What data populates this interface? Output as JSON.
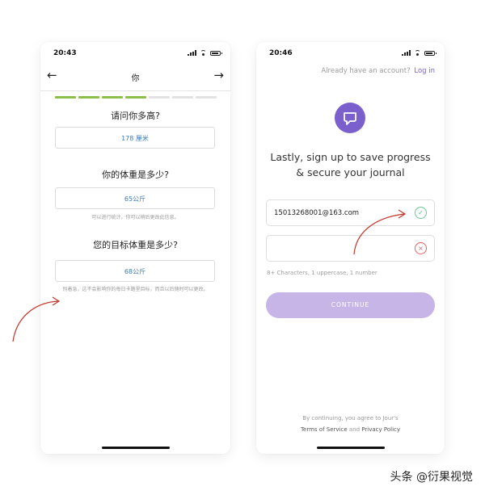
{
  "screen1": {
    "time": "20:43",
    "nav_title": "你",
    "back_icon": "←",
    "forward_icon": "→",
    "progress": {
      "total": 7,
      "completed": 4
    },
    "questions": [
      {
        "label": "请问你多高?",
        "value": "178 厘米",
        "hint": ""
      },
      {
        "label": "你的体重是多少?",
        "value": "65公斤",
        "hint": "可以进行统计。你可以稍后更改此信息。"
      },
      {
        "label": "您的目标体重是多少?",
        "value": "68公斤",
        "hint": "别着急，这不会影响你的每日卡路里目标，而且以后随时可以更改。"
      }
    ]
  },
  "screen2": {
    "time": "20:46",
    "login_prompt": "Already have an account?",
    "login_link": "Log in",
    "logo_icon": "speech-bubble-icon",
    "headline_line1": "Lastly, sign up to save progress",
    "headline_line2": "& secure your journal",
    "email_value": "15013268001@163.com",
    "email_status_icon": "✓",
    "password_value": "",
    "password_status_icon": "×",
    "password_hint": "8+ Characters, 1 uppercase, 1 number",
    "continue_label": "CONTINUE",
    "legal_line1": "By continuing, you agree to Jour's",
    "legal_terms": "Terms of Service",
    "legal_and": "and",
    "legal_privacy": "Privacy Policy"
  },
  "watermark": "头条 @衍果视觉",
  "colors": {
    "progress_on": "#8cc04a",
    "brand_purple": "#7b5fcd",
    "button_disabled": "#c6b5e6",
    "valid_green": "#4fb47d",
    "invalid_red": "#e06363",
    "annotation_red": "#c0392b"
  }
}
